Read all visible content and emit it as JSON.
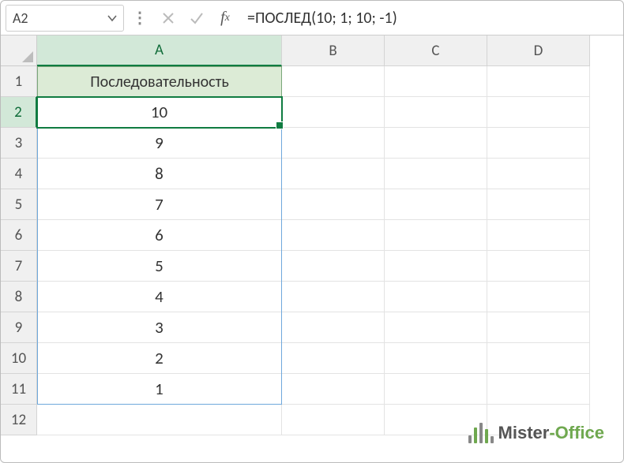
{
  "namebox": {
    "value": "A2"
  },
  "formula": {
    "value": "=ПОСЛЕД(10; 1; 10; -1)"
  },
  "columns": [
    "A",
    "B",
    "C",
    "D"
  ],
  "rows": [
    "1",
    "2",
    "3",
    "4",
    "5",
    "6",
    "7",
    "8",
    "9",
    "10",
    "11",
    "12"
  ],
  "selected": {
    "col": 0,
    "row": 1
  },
  "header_label": "Последовательность",
  "sequence": [
    "10",
    "9",
    "8",
    "7",
    "6",
    "5",
    "4",
    "3",
    "2",
    "1"
  ],
  "spill_range": {
    "top_row": 1,
    "bottom_row": 10,
    "col": 0
  },
  "watermark": {
    "brand1": "Mister",
    "brand2": "-Office"
  }
}
